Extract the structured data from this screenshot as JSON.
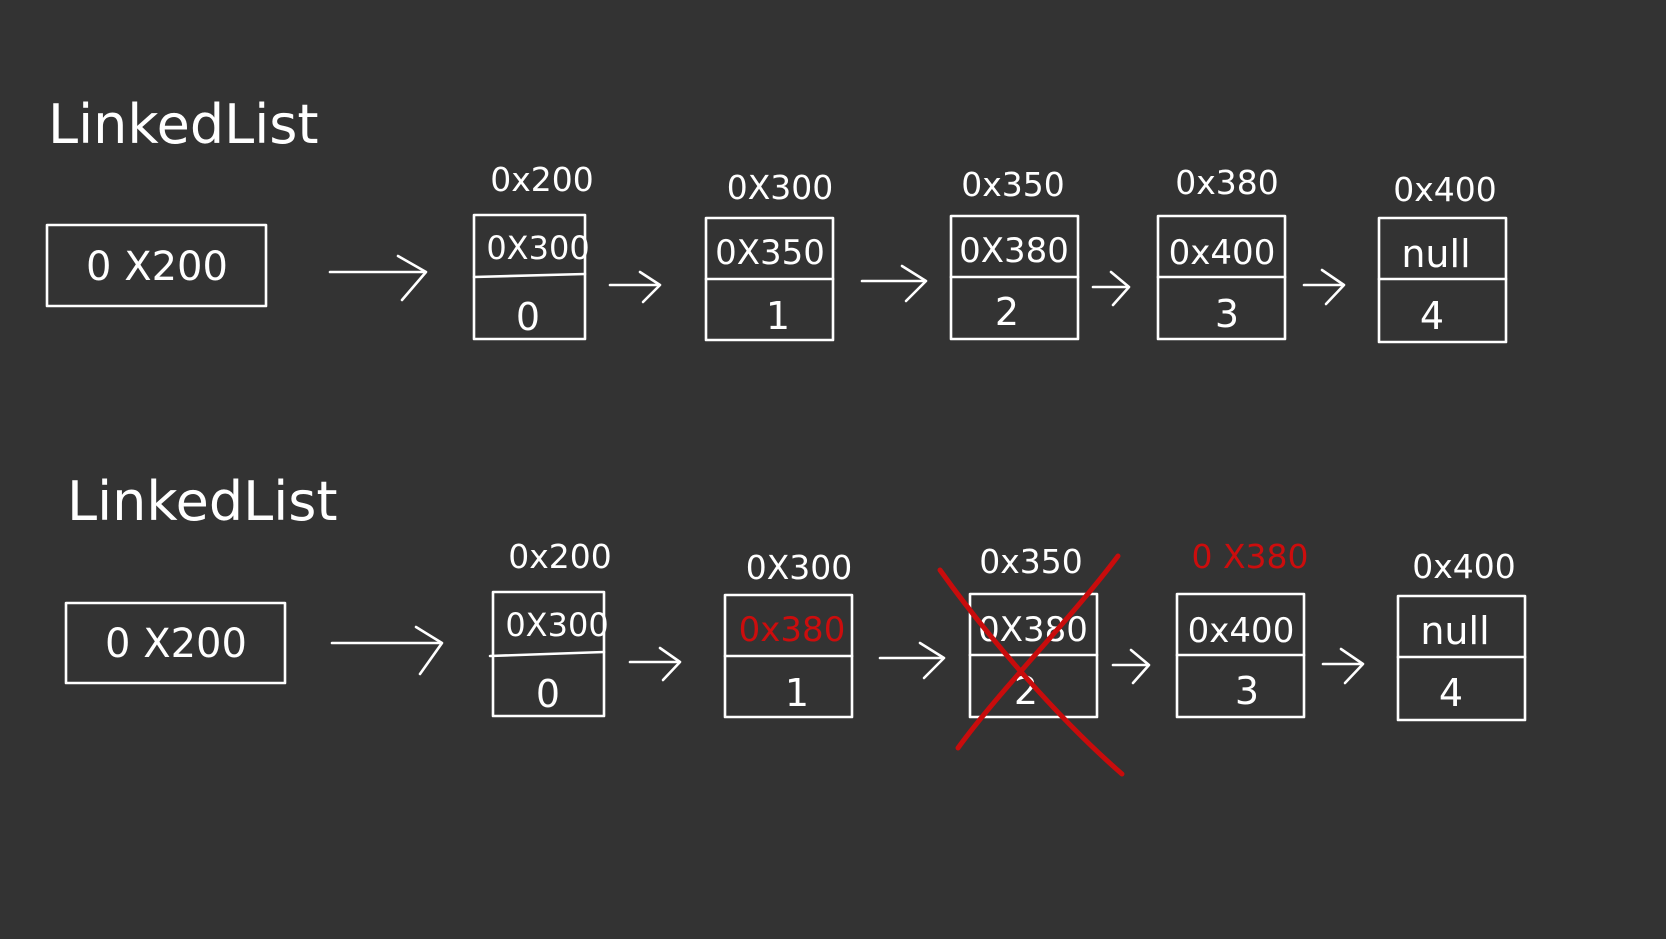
{
  "colors": {
    "background": "#333333",
    "ink": "#ffffff",
    "highlight": "#cc0d0d"
  },
  "diagrams": [
    {
      "title": "LinkedList",
      "head": "0 X200",
      "nodes": [
        {
          "address": "0x200",
          "next": "0X300",
          "value": "0"
        },
        {
          "address": "0X300",
          "next": "0X350",
          "value": "1"
        },
        {
          "address": "0x350",
          "next": "0X380",
          "value": "2"
        },
        {
          "address": "0x380",
          "next": "0x400",
          "value": "3"
        },
        {
          "address": "0x400",
          "next": "null",
          "value": "4"
        }
      ]
    },
    {
      "title": "LinkedList",
      "head": "0 X200",
      "nodes": [
        {
          "address": "0x200",
          "next": "0X300",
          "value": "0",
          "next_changed": false,
          "removed": false
        },
        {
          "address": "0X300",
          "next": "0x380",
          "value": "1",
          "next_changed": true,
          "removed": false
        },
        {
          "address": "0x350",
          "next": "0X380",
          "value": "2",
          "next_changed": false,
          "removed": true
        },
        {
          "address": "0 X380",
          "next": "0x400",
          "value": "3",
          "next_changed": false,
          "removed": false,
          "address_highlighted": true
        },
        {
          "address": "0x400",
          "next": "null",
          "value": "4",
          "next_changed": false,
          "removed": false
        }
      ]
    }
  ]
}
